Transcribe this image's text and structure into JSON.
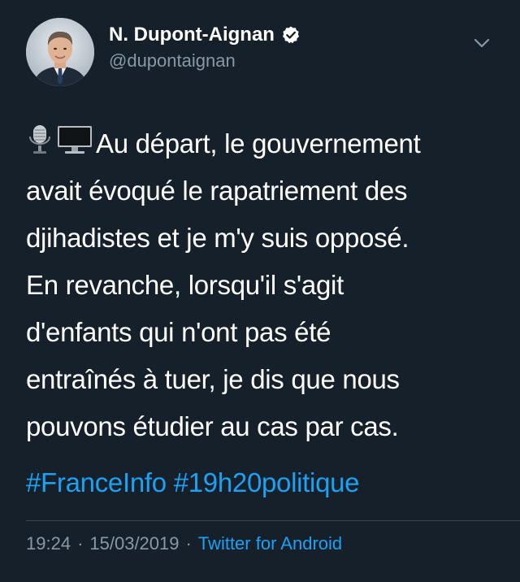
{
  "colors": {
    "background": "#15202b",
    "text": "#ffffff",
    "secondary": "#8899a6",
    "accent": "#1da1f2",
    "divider": "#38444d"
  },
  "author": {
    "display_name": "N. Dupont-Aignan",
    "handle": "@dupontaignan",
    "verified": true,
    "avatar_icon": "profile-photo",
    "verified_icon": "verified-badge-icon"
  },
  "menu": {
    "icon": "chevron-down-icon"
  },
  "tweet": {
    "emojis": [
      "studio-microphone-icon",
      "desktop-computer-icon"
    ],
    "lines": [
      "Au départ, le gouvernement",
      "avait évoqué le rapatriement des",
      "djihadistes et je m'y suis opposé.",
      "En revanche, lorsqu'il s'agit",
      "d'enfants qui n'ont pas été",
      "entraînés à tuer, je dis que nous",
      "pouvons étudier au cas par cas."
    ],
    "hashtags": [
      "#FranceInfo",
      "#19h20politique"
    ]
  },
  "meta": {
    "time": "19:24",
    "separator": "·",
    "date": "15/03/2019",
    "source": "Twitter for Android"
  }
}
